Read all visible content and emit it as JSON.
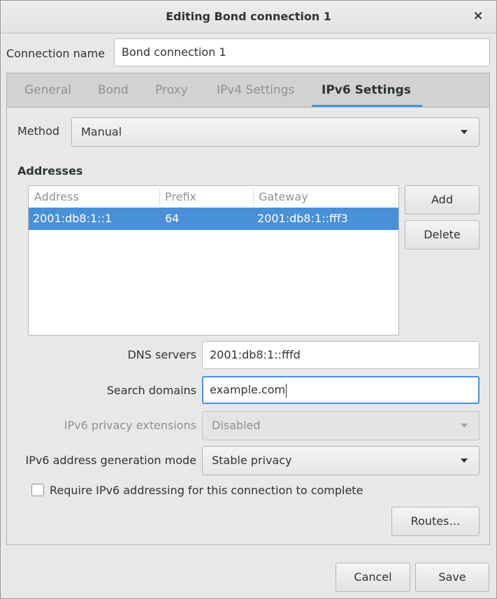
{
  "window": {
    "title": "Editing Bond connection 1",
    "close_glyph": "×"
  },
  "connection": {
    "label": "Connection name",
    "value": "Bond connection 1"
  },
  "tabs": [
    {
      "label": "General",
      "active": false
    },
    {
      "label": "Bond",
      "active": false
    },
    {
      "label": "Proxy",
      "active": false
    },
    {
      "label": "IPv4 Settings",
      "active": false
    },
    {
      "label": "IPv6 Settings",
      "active": true
    }
  ],
  "method": {
    "label": "Method",
    "value": "Manual"
  },
  "addresses": {
    "title": "Addresses",
    "columns": [
      "Address",
      "Prefix",
      "Gateway"
    ],
    "rows": [
      {
        "address": "2001:db8:1::1",
        "prefix": "64",
        "gateway": "2001:db8:1::fff3",
        "selected": true
      }
    ],
    "add_label": "Add",
    "delete_label": "Delete"
  },
  "dns": {
    "label": "DNS servers",
    "value": "2001:db8:1::fffd"
  },
  "search_domains": {
    "label": "Search domains",
    "value": "example.com"
  },
  "privacy": {
    "label": "IPv6 privacy extensions",
    "value": "Disabled",
    "enabled": false
  },
  "addr_gen": {
    "label": "IPv6 address generation mode",
    "value": "Stable privacy"
  },
  "require": {
    "label": "Require IPv6 addressing for this connection to complete",
    "checked": false
  },
  "routes_label": "Routes…",
  "footer": {
    "cancel_label": "Cancel",
    "save_label": "Save"
  },
  "colors": {
    "accent": "#4a90d9",
    "window_bg": "#e8e8e7",
    "tab_bar_bg": "#d2d2d0",
    "text": "#2e3436",
    "dim_text": "#8f9393"
  }
}
